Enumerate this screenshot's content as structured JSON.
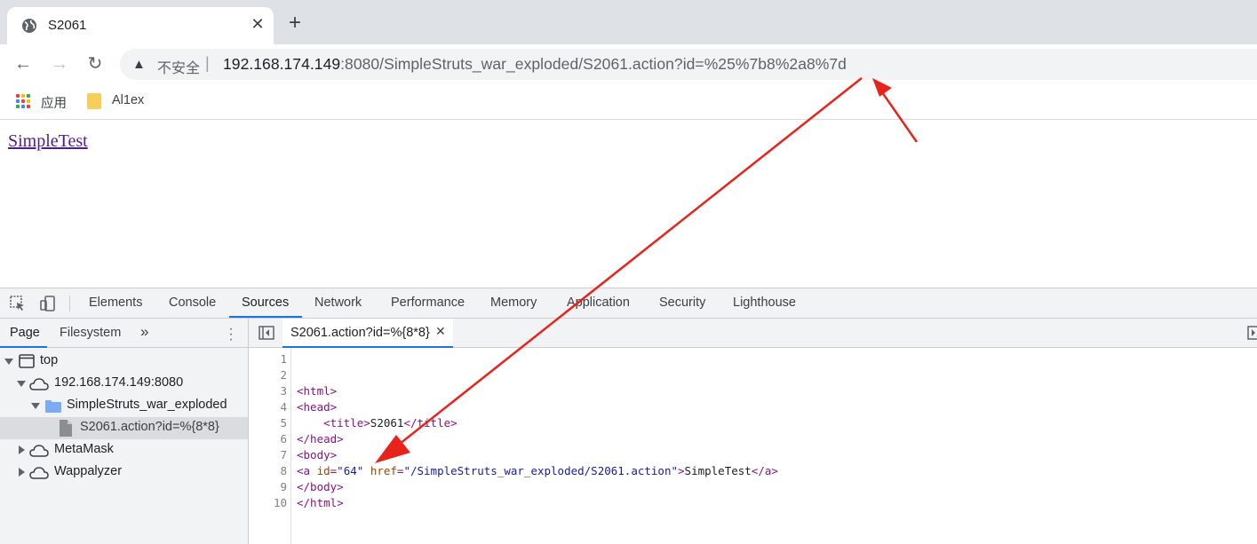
{
  "browser": {
    "tab_title": "S2061",
    "tab_close": "✕",
    "new_tab": "+",
    "back": "←",
    "forward": "→",
    "reload": "↻",
    "security_label": "不安全",
    "separator": "|",
    "url_host": "192.168.174.149",
    "url_rest": ":8080/SimpleStruts_war_exploded/S2061.action?id=%25%7b8%2a8%7d"
  },
  "bookmarks": {
    "items": [
      {
        "label": "应用",
        "icon": "apps-grid-icon"
      },
      {
        "label": "Al1ex",
        "icon": "folder-icon"
      }
    ]
  },
  "page": {
    "link_text": "SimpleTest"
  },
  "devtools": {
    "tabs": [
      "Elements",
      "Console",
      "Sources",
      "Network",
      "Performance",
      "Memory",
      "Application",
      "Security",
      "Lighthouse"
    ],
    "active_tab": "Sources",
    "navigator_tabs": [
      "Page",
      "Filesystem"
    ],
    "more_tabs": "»",
    "tree": [
      {
        "label": "top",
        "icon": "frame-icon"
      },
      {
        "label": "192.168.174.149:8080",
        "icon": "cloud-icon"
      },
      {
        "label": "SimpleStruts_war_exploded",
        "icon": "folder-icon"
      },
      {
        "label": "S2061.action?id=%{8*8}",
        "icon": "file-icon"
      },
      {
        "label": "MetaMask",
        "icon": "cloud-icon"
      },
      {
        "label": "Wappalyzer",
        "icon": "cloud-icon"
      }
    ],
    "open_file": "S2061.action?id=%{8*8}",
    "file_close": "✕",
    "line_numbers": [
      "1",
      "2",
      "3",
      "4",
      "5",
      "6",
      "7",
      "8",
      "9",
      "10"
    ],
    "code": {
      "l3": "<html>",
      "l4": "<head>",
      "l5_open": "    <title>",
      "l5_text": "S2061",
      "l5_close": "</title>",
      "l6": "</head>",
      "l7": "<body>",
      "l8_tag": "<a ",
      "l8_attr1": "id",
      "l8_eq1": "=",
      "l8_val1": "\"64\"",
      "l8_attr2": "href",
      "l8_eq2": "=",
      "l8_val2": "\"/SimpleStruts_war_exploded/S2061.action\"",
      "l8_gt": ">",
      "l8_text": "SimpleTest",
      "l8_close": "</a>",
      "l9": "</body>",
      "l10": "</html>"
    }
  },
  "colors": {
    "annotation_arrow": "#e8231b",
    "accent": "#1a73e8"
  }
}
